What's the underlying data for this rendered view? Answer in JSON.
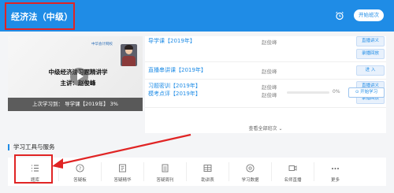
{
  "header": {
    "course_title": "经济法（中级）",
    "switch_button": "开始班次",
    "background_color": "#1f8ce6",
    "highlight_color": "#e02424"
  },
  "video": {
    "logo_text": "中华会计网校",
    "line1": "中级经济法习题精讲学",
    "line2": "主讲：赵俊峰",
    "last_study": "上次学习到： 导学课【2019年】 3%"
  },
  "lessons": [
    {
      "title": "导学课【2019年】",
      "teacher": "赵俊峰",
      "buttons": [
        "直播讲义",
        "录播回放"
      ]
    },
    {
      "title": "直播串讲课【2019年】",
      "teacher": "赵俊峰",
      "buttons": [
        "进 入"
      ]
    },
    {
      "title": "习题密训【2019年】",
      "teacher": "赵俊峰",
      "buttons": [
        "直播讲义",
        "录播回放"
      ]
    },
    {
      "title": "模考点评【2019年】",
      "teacher": "赵俊峰",
      "progress_text": "0%",
      "progress": 0,
      "action": "开始学习"
    }
  ],
  "view_all": "查看全部班次 ⌄",
  "tools": {
    "heading": "学习工具与服务",
    "items": [
      {
        "label": "题库",
        "icon": "list-icon"
      },
      {
        "label": "答疑板",
        "icon": "question-icon"
      },
      {
        "label": "答疑精华",
        "icon": "book-icon"
      },
      {
        "label": "答疑周刊",
        "icon": "document-icon"
      },
      {
        "label": "助讲表",
        "icon": "table-icon"
      },
      {
        "label": "学习数据",
        "icon": "chart-icon"
      },
      {
        "label": "名师直播",
        "icon": "live-icon"
      },
      {
        "label": "更多",
        "icon": "more-icon"
      }
    ]
  }
}
